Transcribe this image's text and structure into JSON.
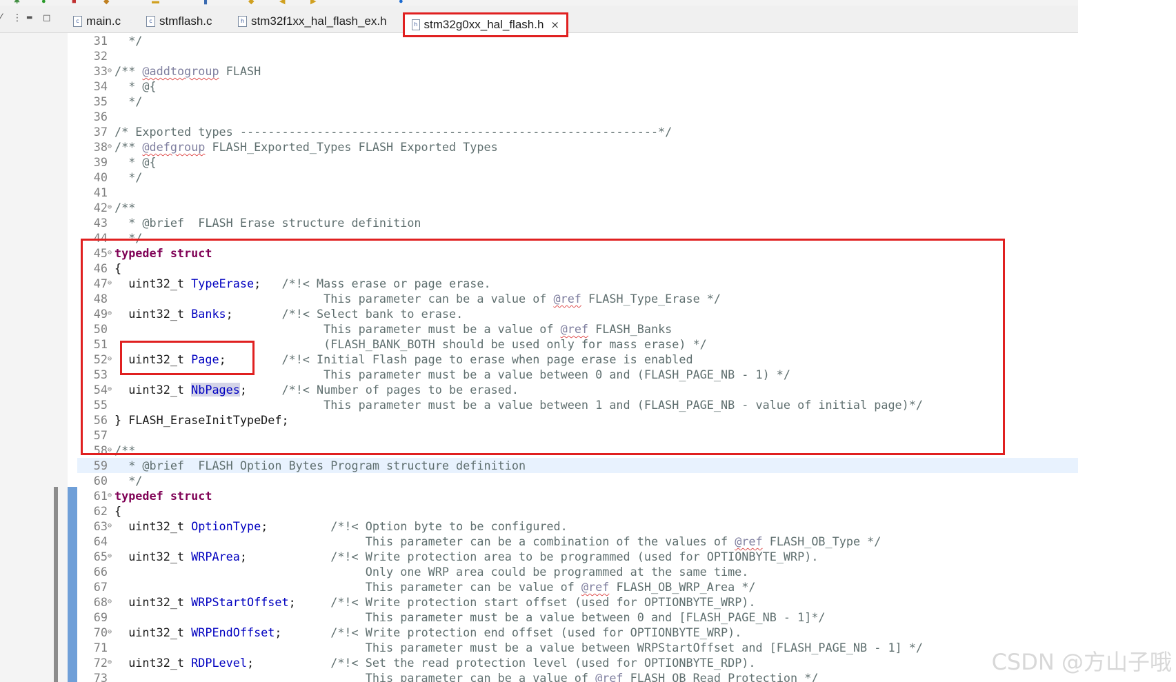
{
  "tabs": [
    {
      "label": "main.c",
      "icon": "c-file-icon"
    },
    {
      "label": "stmflash.c",
      "icon": "c-file-icon"
    },
    {
      "label": "stm32f1xx_hal_flash_ex.h",
      "icon": "h-file-icon"
    },
    {
      "label": "stm32g0xx_hal_flash.h",
      "icon": "h-file-icon",
      "active": true,
      "close": "×"
    }
  ],
  "view_controls": {
    "menu": "⋮",
    "minimize": "▬",
    "maximize": "◻"
  },
  "code": {
    "line_31": {
      "num": "31",
      "text": "  */"
    },
    "line_32": {
      "num": "32"
    },
    "line_33": {
      "num": "33",
      "pre": "/** ",
      "tag": "@addtogroup",
      "post": " FLASH"
    },
    "line_34": {
      "num": "34",
      "text": "  * @{"
    },
    "line_35": {
      "num": "35",
      "text": "  */"
    },
    "line_36": {
      "num": "36"
    },
    "line_37": {
      "num": "37",
      "text": "/* Exported types ------------------------------------------------------------*/"
    },
    "line_38": {
      "num": "38",
      "pre": "/** ",
      "tag": "@defgroup",
      "post": " FLASH_Exported_Types FLASH Exported Types"
    },
    "line_39": {
      "num": "39",
      "text": "  * @{"
    },
    "line_40": {
      "num": "40",
      "text": "  */"
    },
    "line_41": {
      "num": "41"
    },
    "line_42": {
      "num": "42",
      "text": "/**"
    },
    "line_43": {
      "num": "43",
      "text": "  * @brief  FLASH Erase structure definition"
    },
    "line_44": {
      "num": "44",
      "text": "  */"
    },
    "line_45": {
      "num": "45",
      "kw": "typedef struct"
    },
    "line_46": {
      "num": "46",
      "text": "{"
    },
    "line_47": {
      "num": "47",
      "type": "  uint32_t ",
      "field": "TypeErase",
      "semi": ";",
      "comment": "   /*!< Mass erase or page erase."
    },
    "line_48": {
      "num": "48",
      "pre": "                              This parameter can be a value of ",
      "tag": "@ref",
      "post": " FLASH_Type_Erase */"
    },
    "line_49": {
      "num": "49",
      "type": "  uint32_t ",
      "field": "Banks",
      "semi": ";",
      "comment": "       /*!< Select bank to erase."
    },
    "line_50": {
      "num": "50",
      "pre": "                              This parameter must be a value of ",
      "tag": "@ref",
      "post": " FLASH_Banks"
    },
    "line_51": {
      "num": "51",
      "text": "                              (FLASH_BANK_BOTH should be used only for mass erase) */"
    },
    "line_52": {
      "num": "52",
      "type": "  uint32_t ",
      "field": "Page",
      "semi": ";",
      "comment": "        /*!< Initial Flash page to erase when page erase is enabled"
    },
    "line_53": {
      "num": "53",
      "text": "                              This parameter must be a value between 0 and (FLASH_PAGE_NB - 1) */"
    },
    "line_54": {
      "num": "54",
      "type": "  uint32_t ",
      "field": "NbPages",
      "semi": ";",
      "comment": "     /*!< Number of pages to be erased."
    },
    "line_55": {
      "num": "55",
      "text": "                              This parameter must be a value between 1 and (FLASH_PAGE_NB - value of initial page)*/"
    },
    "line_56": {
      "num": "56",
      "text": "} FLASH_EraseInitTypeDef;"
    },
    "line_57": {
      "num": "57"
    },
    "line_58": {
      "num": "58",
      "text": "/**"
    },
    "line_59": {
      "num": "59",
      "text": "  * @brief  FLASH Option Bytes Program structure definition"
    },
    "line_60": {
      "num": "60",
      "text": "  */"
    },
    "line_61": {
      "num": "61",
      "kw": "typedef struct"
    },
    "line_62": {
      "num": "62",
      "text": "{"
    },
    "line_63": {
      "num": "63",
      "type": "  uint32_t ",
      "field": "OptionType",
      "semi": ";",
      "comment": "         /*!< Option byte to be configured."
    },
    "line_64": {
      "num": "64",
      "pre": "                                    This parameter can be a combination of the values of ",
      "tag": "@ref",
      "post": " FLASH_OB_Type */"
    },
    "line_65": {
      "num": "65",
      "type": "  uint32_t ",
      "field": "WRPArea",
      "semi": ";",
      "comment": "            /*!< Write protection area to be programmed (used for OPTIONBYTE_WRP)."
    },
    "line_66": {
      "num": "66",
      "text": "                                    Only one WRP area could be programmed at the same time."
    },
    "line_67": {
      "num": "67",
      "pre": "                                    This parameter can be value of ",
      "tag": "@ref",
      "post": " FLASH_OB_WRP_Area */"
    },
    "line_68": {
      "num": "68",
      "type": "  uint32_t ",
      "field": "WRPStartOffset",
      "semi": ";",
      "comment": "     /*!< Write protection start offset (used for OPTIONBYTE_WRP)."
    },
    "line_69": {
      "num": "69",
      "text": "                                    This parameter must be a value between 0 and [FLASH_PAGE_NB - 1]*/"
    },
    "line_70": {
      "num": "70",
      "type": "  uint32_t ",
      "field": "WRPEndOffset",
      "semi": ";",
      "comment": "       /*!< Write protection end offset (used for OPTIONBYTE_WRP)."
    },
    "line_71": {
      "num": "71",
      "text": "                                    This parameter must be a value between WRPStartOffset and [FLASH_PAGE_NB - 1] */"
    },
    "line_72": {
      "num": "72",
      "type": "  uint32_t ",
      "field": "RDPLevel",
      "semi": ";",
      "comment": "           /*!< Set the read protection level (used for OPTIONBYTE_RDP)."
    },
    "line_73": {
      "num": "73",
      "pre": "                                    This parameter can be a value of ",
      "tag": "@ref",
      "post": " FLASH_OB_Read_Protection */"
    }
  },
  "watermark": "CSDN @方山子哦",
  "colors": {
    "highlight_box": "#e02020",
    "keyword": "#7f0055",
    "field": "#0000c0"
  }
}
